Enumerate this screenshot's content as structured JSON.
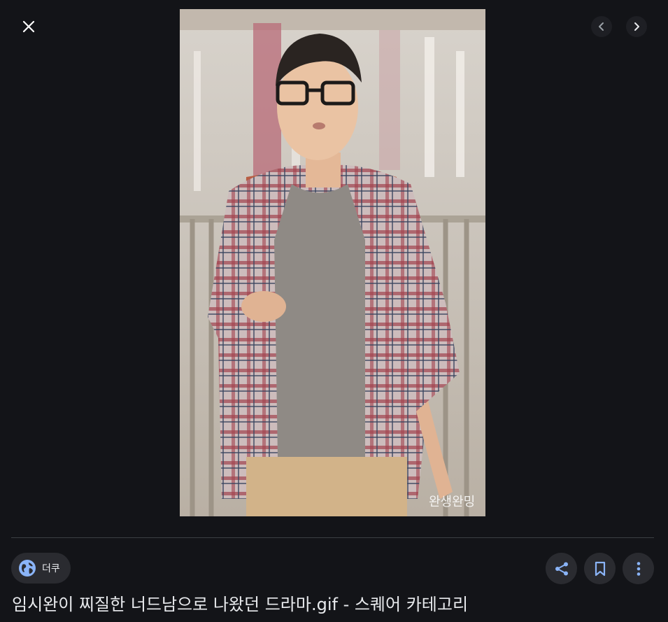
{
  "viewer": {
    "image_alt": "임시완이 찌질한 너드남으로 나왔던 드라마.gif - 스퀘어 카테고리",
    "watermark": "완생완밍"
  },
  "source": {
    "name": "더쿠",
    "icon": "globe-icon"
  },
  "controls": {
    "close_icon": "close-icon",
    "prev_icon": "chevron-left-icon",
    "next_icon": "chevron-right-icon",
    "share_icon": "share-icon",
    "bookmark_icon": "bookmark-icon",
    "more_icon": "more-vert-icon"
  },
  "title": "임시완이 찌질한 너드남으로 나왔던 드라마.gif - 스퀘어 카테고리",
  "colors": {
    "background": "#131418",
    "chip": "#2a2b30",
    "accent": "#8ab4f8"
  }
}
